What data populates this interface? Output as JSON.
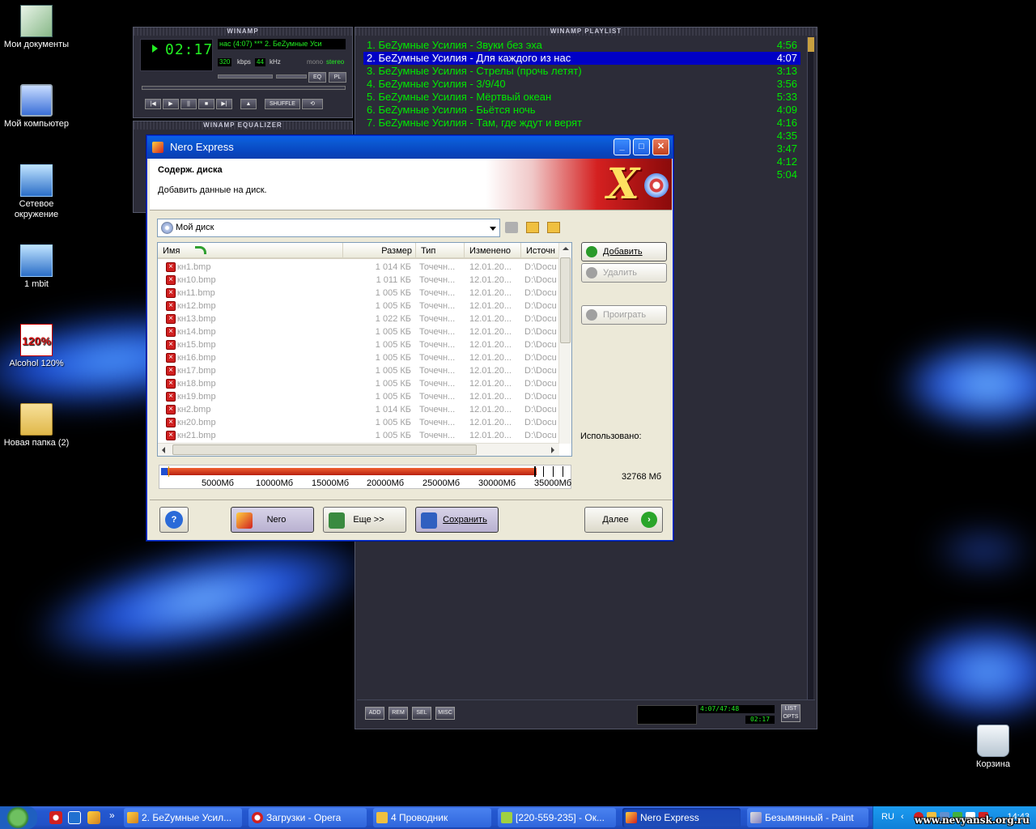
{
  "desktop": {
    "icons": [
      {
        "label": "Мои документы",
        "icon": "my-documents-icon"
      },
      {
        "label": "Мой компьютер",
        "icon": "my-computer-icon"
      },
      {
        "label": "Сетевое окружение",
        "icon": "network-icon"
      },
      {
        "label": "1 mbit",
        "icon": "network-connection-icon"
      },
      {
        "label": "Alcohol 120%",
        "icon": "alcohol-icon",
        "logo_text": "120%"
      },
      {
        "label": "Новая папка (2)",
        "icon": "folder-icon"
      },
      {
        "label": "Корзина",
        "icon": "recycle-bin-icon"
      }
    ]
  },
  "winamp": {
    "title": "WINAMP",
    "time": "02:17",
    "marquee": "нас (4:07)  ***  2. БеZумные Уси",
    "kbps": "320",
    "kbps_label": "kbps",
    "khz": "44",
    "khz_label": "kHz",
    "mono": "mono",
    "stereo": "stereo",
    "eq_btn": "EQ",
    "pl_btn": "PL",
    "shuffle": "SHUFFLE",
    "equalizer_title": "WINAMP EQUALIZER"
  },
  "playlist": {
    "title": "WINAMP PLAYLIST",
    "tracks": [
      {
        "title": "1. БеZумные Усилия - Звуки без эха",
        "duration": "4:56"
      },
      {
        "title": "2. БеZумные Усилия - Для каждого из нас",
        "duration": "4:07",
        "selected": true
      },
      {
        "title": "3. БеZумные Усилия - Стрелы (прочь летят)",
        "duration": "3:13"
      },
      {
        "title": "4. БеZумные Усилия - 3/9/40",
        "duration": "3:56"
      },
      {
        "title": "5. БеZумные Усилия - Мёртвый океан",
        "duration": "5:33"
      },
      {
        "title": "6. БеZумные Усилия - Бьётся ночь",
        "duration": "4:09"
      },
      {
        "title": "7. БеZумные Усилия - Там, где ждут и верят",
        "duration": "4:16"
      },
      {
        "title": "",
        "duration": "4:35"
      },
      {
        "title": "",
        "duration": "3:47"
      },
      {
        "title": "",
        "duration": "4:12"
      },
      {
        "title": "",
        "duration": "5:04"
      }
    ],
    "buttons": {
      "add": "ADD",
      "rem": "REM",
      "sel": "SEL",
      "misc": "MISC",
      "list": "LIST OPTS"
    },
    "total_time": "4:07/47:48",
    "mini_time": "02:17"
  },
  "nero": {
    "title": "Nero Express",
    "header_title": "Содерж. диска",
    "header_subtitle": "Добавить данные на диск.",
    "disc_name": "Мой диск",
    "columns": [
      "Имя",
      "Размер",
      "Тип",
      "Изменено",
      "Источн"
    ],
    "files": [
      {
        "name": "кн1.bmp",
        "size": "1 014 КБ",
        "type": "Точечн...",
        "modified": "12.01.20...",
        "source": "D:\\Docu"
      },
      {
        "name": "кн10.bmp",
        "size": "1 011 КБ",
        "type": "Точечн...",
        "modified": "12.01.20...",
        "source": "D:\\Docu"
      },
      {
        "name": "кн11.bmp",
        "size": "1 005 КБ",
        "type": "Точечн...",
        "modified": "12.01.20...",
        "source": "D:\\Docu"
      },
      {
        "name": "кн12.bmp",
        "size": "1 005 КБ",
        "type": "Точечн...",
        "modified": "12.01.20...",
        "source": "D:\\Docu"
      },
      {
        "name": "кн13.bmp",
        "size": "1 022 КБ",
        "type": "Точечн...",
        "modified": "12.01.20...",
        "source": "D:\\Docu"
      },
      {
        "name": "кн14.bmp",
        "size": "1 005 КБ",
        "type": "Точечн...",
        "modified": "12.01.20...",
        "source": "D:\\Docu"
      },
      {
        "name": "кн15.bmp",
        "size": "1 005 КБ",
        "type": "Точечн...",
        "modified": "12.01.20...",
        "source": "D:\\Docu"
      },
      {
        "name": "кн16.bmp",
        "size": "1 005 КБ",
        "type": "Точечн...",
        "modified": "12.01.20...",
        "source": "D:\\Docu"
      },
      {
        "name": "кн17.bmp",
        "size": "1 005 КБ",
        "type": "Точечн...",
        "modified": "12.01.20...",
        "source": "D:\\Docu"
      },
      {
        "name": "кн18.bmp",
        "size": "1 005 КБ",
        "type": "Точечн...",
        "modified": "12.01.20...",
        "source": "D:\\Docu"
      },
      {
        "name": "кн19.bmp",
        "size": "1 005 КБ",
        "type": "Точечн...",
        "modified": "12.01.20...",
        "source": "D:\\Docu"
      },
      {
        "name": "кн2.bmp",
        "size": "1 014 КБ",
        "type": "Точечн...",
        "modified": "12.01.20...",
        "source": "D:\\Docu"
      },
      {
        "name": "кн20.bmp",
        "size": "1 005 КБ",
        "type": "Точечн...",
        "modified": "12.01.20...",
        "source": "D:\\Docu"
      },
      {
        "name": "кн21.bmp",
        "size": "1 005 КБ",
        "type": "Точечн...",
        "modified": "12.01.20...",
        "source": "D:\\Docu"
      }
    ],
    "side_buttons": {
      "add": "Добавить",
      "delete": "Удалить",
      "play": "Проиграть"
    },
    "used_label": "Использовано:",
    "capacity_ticks": [
      "5000Мб",
      "10000Мб",
      "15000Мб",
      "20000Мб",
      "25000Мб",
      "30000Мб",
      "35000Мб"
    ],
    "capacity_used_fraction": 0.92,
    "capacity_size": "32768 Мб",
    "bottom_buttons": {
      "help": "?",
      "nero": "Nero",
      "more": "Еще >>",
      "save": "Сохранить",
      "next": "Далее"
    }
  },
  "taskbar": {
    "items": [
      {
        "label": "2. БеZумные Усил...",
        "icon": "winamp-icon"
      },
      {
        "label": "Загрузки - Opera",
        "icon": "opera-icon"
      },
      {
        "label": "4 Проводник",
        "icon": "folder-icon"
      },
      {
        "label": "[220-559-235] - Ок...",
        "icon": "chat-icon"
      },
      {
        "label": "Nero Express",
        "icon": "nero-icon",
        "active": true
      },
      {
        "label": "Безымянный - Paint",
        "icon": "paint-icon"
      }
    ],
    "lang": "RU",
    "clock": "14:43"
  },
  "watermark": "www.nevyansk.org.ru",
  "colors": {
    "playlist_green": "#00e800",
    "playlist_selection": "#0000c6",
    "xp_title_blue": "#0a5fe8",
    "taskbar_blue": "#2458d0"
  }
}
